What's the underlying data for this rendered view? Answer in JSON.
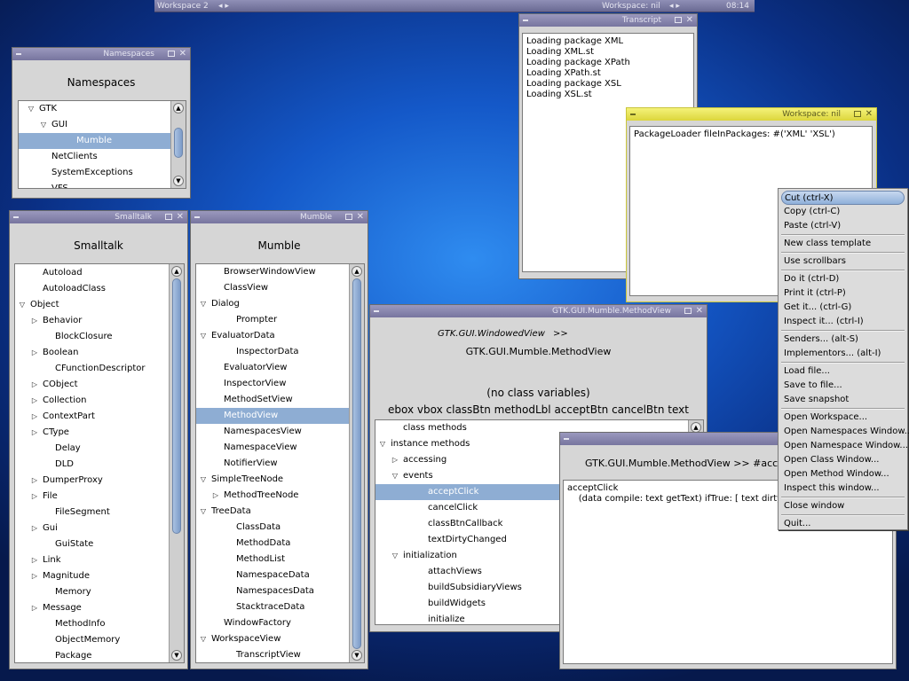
{
  "top_panel": {
    "workspace": "Workspace 2",
    "nav": "◂ ▸",
    "center": "Workspace: nil",
    "clock": "08:14"
  },
  "namespaces": {
    "title": "Namespaces",
    "heading": "Namespaces",
    "rows": [
      {
        "label": "GTK",
        "tri": "▽"
      },
      {
        "label": "GUI",
        "tri": "▽"
      },
      {
        "label": "Mumble",
        "tri": ""
      },
      {
        "label": "NetClients",
        "tri": ""
      },
      {
        "label": "SystemExceptions",
        "tri": ""
      },
      {
        "label": "VFS",
        "tri": ""
      }
    ]
  },
  "smalltalk": {
    "title": "Smalltalk",
    "heading": "Smalltalk",
    "rows": [
      {
        "label": "Autoload",
        "tri": ""
      },
      {
        "label": "AutoloadClass",
        "tri": ""
      },
      {
        "label": "Object",
        "tri": "▽"
      },
      {
        "label": "Behavior",
        "tri": "▷"
      },
      {
        "label": "BlockClosure",
        "tri": ""
      },
      {
        "label": "Boolean",
        "tri": "▷"
      },
      {
        "label": "CFunctionDescriptor",
        "tri": ""
      },
      {
        "label": "CObject",
        "tri": "▷"
      },
      {
        "label": "Collection",
        "tri": "▷"
      },
      {
        "label": "ContextPart",
        "tri": "▷"
      },
      {
        "label": "CType",
        "tri": "▷"
      },
      {
        "label": "Delay",
        "tri": ""
      },
      {
        "label": "DLD",
        "tri": ""
      },
      {
        "label": "DumperProxy",
        "tri": "▷"
      },
      {
        "label": "File",
        "tri": "▷"
      },
      {
        "label": "FileSegment",
        "tri": ""
      },
      {
        "label": "Gui",
        "tri": "▷"
      },
      {
        "label": "GuiState",
        "tri": ""
      },
      {
        "label": "Link",
        "tri": "▷"
      },
      {
        "label": "Magnitude",
        "tri": "▷"
      },
      {
        "label": "Memory",
        "tri": ""
      },
      {
        "label": "Message",
        "tri": "▷"
      },
      {
        "label": "MethodInfo",
        "tri": ""
      },
      {
        "label": "ObjectMemory",
        "tri": ""
      },
      {
        "label": "Package",
        "tri": ""
      }
    ]
  },
  "mumble": {
    "title": "Mumble",
    "heading": "Mumble",
    "rows": [
      {
        "label": "BrowserWindowView",
        "tri": ""
      },
      {
        "label": "ClassView",
        "tri": ""
      },
      {
        "label": "Dialog",
        "tri": "▽"
      },
      {
        "label": "Prompter",
        "tri": ""
      },
      {
        "label": "EvaluatorData",
        "tri": "▽"
      },
      {
        "label": "InspectorData",
        "tri": ""
      },
      {
        "label": "EvaluatorView",
        "tri": ""
      },
      {
        "label": "InspectorView",
        "tri": ""
      },
      {
        "label": "MethodSetView",
        "tri": ""
      },
      {
        "label": "MethodView",
        "tri": ""
      },
      {
        "label": "NamespacesView",
        "tri": ""
      },
      {
        "label": "NamespaceView",
        "tri": ""
      },
      {
        "label": "NotifierView",
        "tri": ""
      },
      {
        "label": "SimpleTreeNode",
        "tri": "▽"
      },
      {
        "label": "MethodTreeNode",
        "tri": "▷"
      },
      {
        "label": "TreeData",
        "tri": "▽"
      },
      {
        "label": "ClassData",
        "tri": ""
      },
      {
        "label": "MethodData",
        "tri": ""
      },
      {
        "label": "MethodList",
        "tri": ""
      },
      {
        "label": "NamespaceData",
        "tri": ""
      },
      {
        "label": "NamespacesData",
        "tri": ""
      },
      {
        "label": "StacktraceData",
        "tri": ""
      },
      {
        "label": "WindowFactory",
        "tri": ""
      },
      {
        "label": "WorkspaceView",
        "tri": "▽"
      },
      {
        "label": "TranscriptView",
        "tri": ""
      }
    ]
  },
  "methodview": {
    "title": "GTK.GUI.Mumble.MethodView",
    "superclass": "GTK.GUI.WindowedView",
    "arrows": ">>",
    "classname": "GTK.GUI.Mumble.MethodView",
    "classvars": "(no class variables)",
    "ivars": "ebox vbox classBtn methodLbl acceptBtn cancelBtn text",
    "rows": [
      {
        "label": "class methods",
        "tri": ""
      },
      {
        "label": "instance methods",
        "tri": "▽"
      },
      {
        "label": "accessing",
        "tri": "▷"
      },
      {
        "label": "events",
        "tri": "▽"
      },
      {
        "label": "acceptClick",
        "tri": ""
      },
      {
        "label": "cancelClick",
        "tri": ""
      },
      {
        "label": "classBtnCallback",
        "tri": ""
      },
      {
        "label": "textDirtyChanged",
        "tri": ""
      },
      {
        "label": "initialization",
        "tri": "▽"
      },
      {
        "label": "attachViews",
        "tri": ""
      },
      {
        "label": "buildSubsidiaryViews",
        "tri": ""
      },
      {
        "label": "buildWidgets",
        "tri": ""
      },
      {
        "label": "initialize",
        "tri": ""
      }
    ]
  },
  "editor": {
    "header": "GTK.GUI.Mumble.MethodView  >> #acc",
    "code": "acceptClick\n    (data compile: text getText) ifTrue: [ text dirty: fal"
  },
  "transcript": {
    "title": "Transcript",
    "text": "Loading package XML\nLoading XML.st\nLoading package XPath\nLoading XPath.st\nLoading package XSL\nLoading XSL.st"
  },
  "workspace": {
    "title": "Workspace: nil",
    "text": "PackageLoader fileInPackages: #('XML' 'XSL')"
  },
  "context_menu": [
    {
      "label": "Cut (ctrl-X)",
      "type": "item"
    },
    {
      "label": "Copy (ctrl-C)",
      "type": "item"
    },
    {
      "label": "Paste (ctrl-V)",
      "type": "item"
    },
    {
      "type": "sep"
    },
    {
      "label": "New class template",
      "type": "item"
    },
    {
      "type": "sep"
    },
    {
      "label": "Use scrollbars",
      "type": "item"
    },
    {
      "type": "sep"
    },
    {
      "label": "Do it (ctrl-D)",
      "type": "item"
    },
    {
      "label": "Print it (ctrl-P)",
      "type": "item"
    },
    {
      "label": "Get it... (ctrl-G)",
      "type": "item"
    },
    {
      "label": "Inspect it... (ctrl-I)",
      "type": "item"
    },
    {
      "type": "sep"
    },
    {
      "label": "Senders... (alt-S)",
      "type": "item"
    },
    {
      "label": "Implementors... (alt-I)",
      "type": "item"
    },
    {
      "type": "sep"
    },
    {
      "label": "Load file...",
      "type": "item"
    },
    {
      "label": "Save to file...",
      "type": "item"
    },
    {
      "label": "Save snapshot",
      "type": "item"
    },
    {
      "type": "sep"
    },
    {
      "label": "Open Workspace...",
      "type": "item"
    },
    {
      "label": "Open Namespaces Window...",
      "type": "item"
    },
    {
      "label": "Open Namespace Window...",
      "type": "item"
    },
    {
      "label": "Open Class Window...",
      "type": "item"
    },
    {
      "label": "Open Method Window...",
      "type": "item"
    },
    {
      "label": "Inspect this window...",
      "type": "item"
    },
    {
      "type": "sep"
    },
    {
      "label": "Close window",
      "type": "item"
    },
    {
      "type": "sep"
    },
    {
      "label": "Quit...",
      "type": "item"
    }
  ],
  "icons": {
    "close": "✕",
    "scroll_up": "▲",
    "scroll_down": "▼"
  },
  "colors": {
    "selection": "#8eadd3",
    "title_inactive": "#8684ad",
    "title_active": "#eeea5e"
  }
}
